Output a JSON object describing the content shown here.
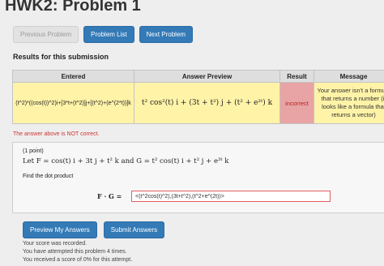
{
  "page": {
    "title": "HWK2: Problem 1"
  },
  "nav": {
    "previous_label": "Previous Problem",
    "list_label": "Problem List",
    "next_label": "Next Problem"
  },
  "results": {
    "heading": "Results for this submission",
    "columns": [
      "Entered",
      "Answer Preview",
      "Result",
      "Message"
    ],
    "row": {
      "entered": "(t^2)*((cos(t))^2)i+[3*t+(t^2)]j+[(t^2)+(e^(2*t))]k",
      "preview": "t² cos²(t) i + (3t + t²) j + (t² + e²ᵗ) k",
      "result": "incorrect",
      "message": "Your answer isn't a formula that returns a number (it looks like a formula that returns a vector)"
    },
    "not_correct": "The answer above is NOT correct."
  },
  "problem": {
    "points": "(1 point)",
    "let_text": "Let F = cos(t) i + 3t j + t² k and G = t² cos(t) i + t² j + e³ᵗ k",
    "find_text": "Find the dot product",
    "dot_label": "F · G =",
    "answer_value": "<(t^2cos(t)^2),(3t+t^2),(t^2+e^(2t))>"
  },
  "actions": {
    "preview_label": "Preview My Answers",
    "submit_label": "Submit Answers"
  },
  "status": {
    "recorded": "Your score was recorded.",
    "attempts": "You have attempted this problem 4 times.",
    "score": "You received a score of 0% for this attempt."
  },
  "colors": {
    "primary_button": "#337ab7",
    "incorrect_bg": "#e8a4a4",
    "highlight_bg": "#fff3a8",
    "error_text": "#cc3333"
  }
}
